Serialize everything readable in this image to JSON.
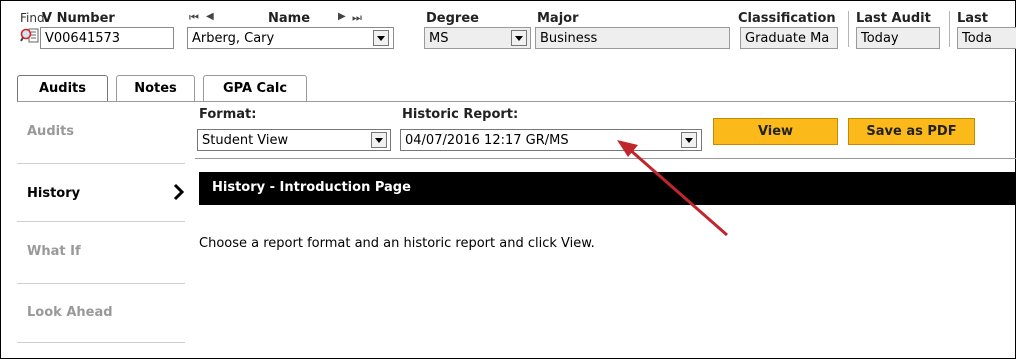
{
  "header": {
    "find_label": "Find",
    "v_number": {
      "label": "V Number",
      "value": "V00641573"
    },
    "nav": {
      "first": "⏮",
      "prev": "◀",
      "next": "▶",
      "last": "⏭"
    },
    "name": {
      "label": "Name",
      "value": "Arberg, Cary"
    },
    "degree": {
      "label": "Degree",
      "value": "MS"
    },
    "major": {
      "label": "Major",
      "value": "Business"
    },
    "classification": {
      "label": "Classification",
      "value": "Graduate Ma"
    },
    "last_audit": {
      "label": "Last Audit",
      "value": "Today"
    },
    "last_col": {
      "label": "Last",
      "value": "Toda"
    }
  },
  "tabs": [
    "Audits",
    "Notes",
    "GPA Calc"
  ],
  "sidebar": {
    "items": [
      {
        "label": "Audits"
      },
      {
        "label": "History"
      },
      {
        "label": "What If"
      },
      {
        "label": "Look Ahead"
      }
    ]
  },
  "toolbar": {
    "format_label": "Format:",
    "format_value": "Student View",
    "historic_label": "Historic Report:",
    "historic_value": "04/07/2016 12:17 GR/MS",
    "view_button": "View",
    "pdf_button": "Save as PDF"
  },
  "content": {
    "section_title": "History - Introduction Page",
    "instructions": "Choose a report format and an historic report and click View."
  },
  "colors": {
    "accent": "#fcb91a",
    "header_bar": "#000000",
    "arrow": "#c0272d"
  }
}
